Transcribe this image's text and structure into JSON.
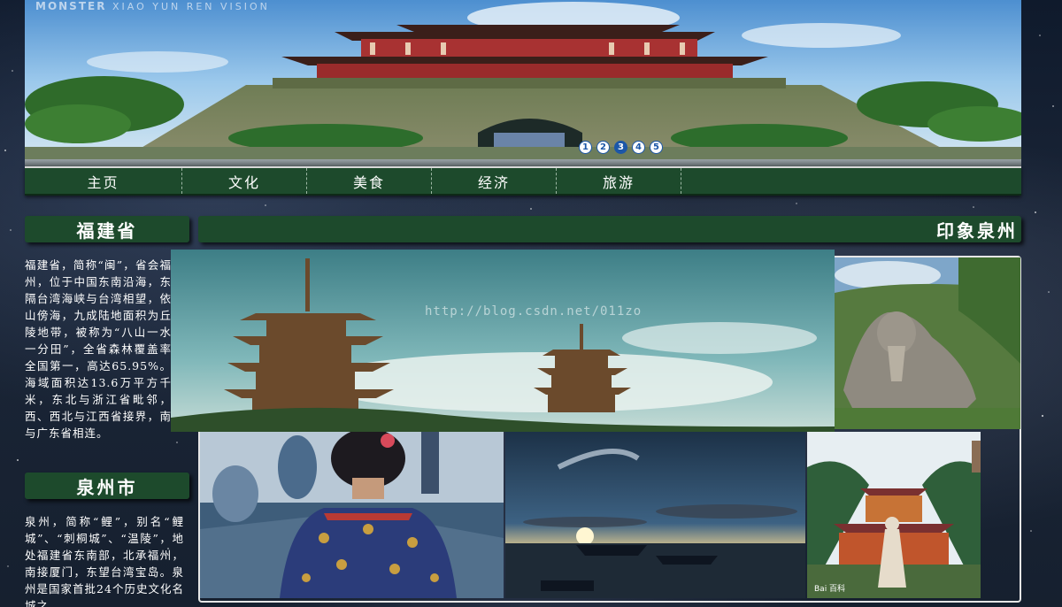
{
  "banner": {
    "brand_main": "MONSTER",
    "brand_sub": "XIAO YUN REN VISION",
    "slides": [
      "1",
      "2",
      "3",
      "4",
      "5"
    ],
    "active_slide": 3
  },
  "nav": {
    "items": [
      "主页",
      "文化",
      "美食",
      "经济",
      "旅游"
    ]
  },
  "fujian": {
    "heading": "福建省",
    "text": "福建省，简称“闽”，省会福州，位于中国东南沿海，东隔台湾海峡与台湾相望，依山傍海，九成陆地面积为丘陵地带，被称为“八山一水一分田”，全省森林覆盖率全国第一，高达65.95%。海域面积达13.6万平方千米，东北与浙江省毗邻，西、西北与江西省接界，南与广东省相连。"
  },
  "quanzhou": {
    "heading": "泉州市",
    "text": "泉州，简称“鲤”，别名“鲤城”、“刺桐城”、“温陵”，地处福建省东南部，北承福州，南接厦门，东望台湾宝岛。泉州是国家首批24个历史文化名城之"
  },
  "gallery": {
    "heading": "印象泉州",
    "watermark": "http://blog.csdn.net/011zo",
    "baidu_mark": "Bai 百科"
  },
  "colors": {
    "nav_green": "#1d4a2c",
    "accent_blue": "#1c57a8"
  }
}
